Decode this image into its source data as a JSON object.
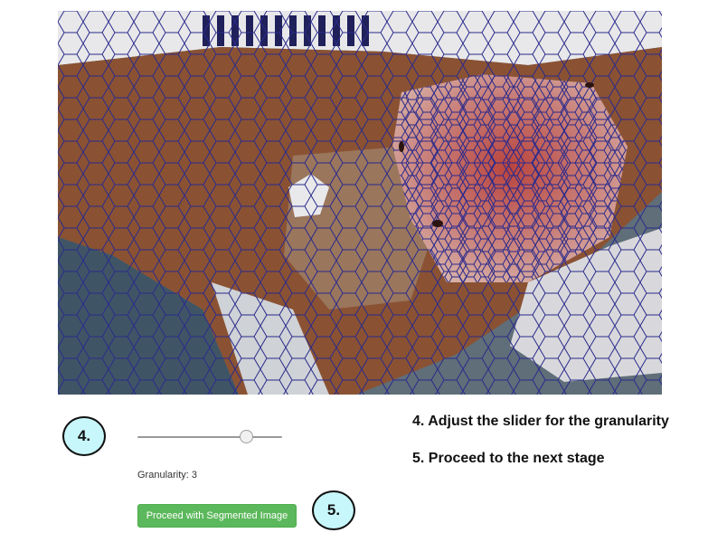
{
  "slider": {
    "value": 3,
    "min": 0,
    "max": 4
  },
  "granularity": {
    "label": "Granularity: 3"
  },
  "buttons": {
    "proceed_label": "Proceed with Segmented Image"
  },
  "steps": {
    "step4": {
      "badge": "4.",
      "instruction": "4. Adjust the slider for the granularity"
    },
    "step5": {
      "badge": "5.",
      "instruction": "5. Proceed to the next stage"
    }
  },
  "colors": {
    "badge_fill": "#c8f7fb",
    "button_green": "#5cb85c",
    "segment_outline": "#2a2a8c"
  },
  "image": {
    "icon": "segmented-wound-image"
  }
}
